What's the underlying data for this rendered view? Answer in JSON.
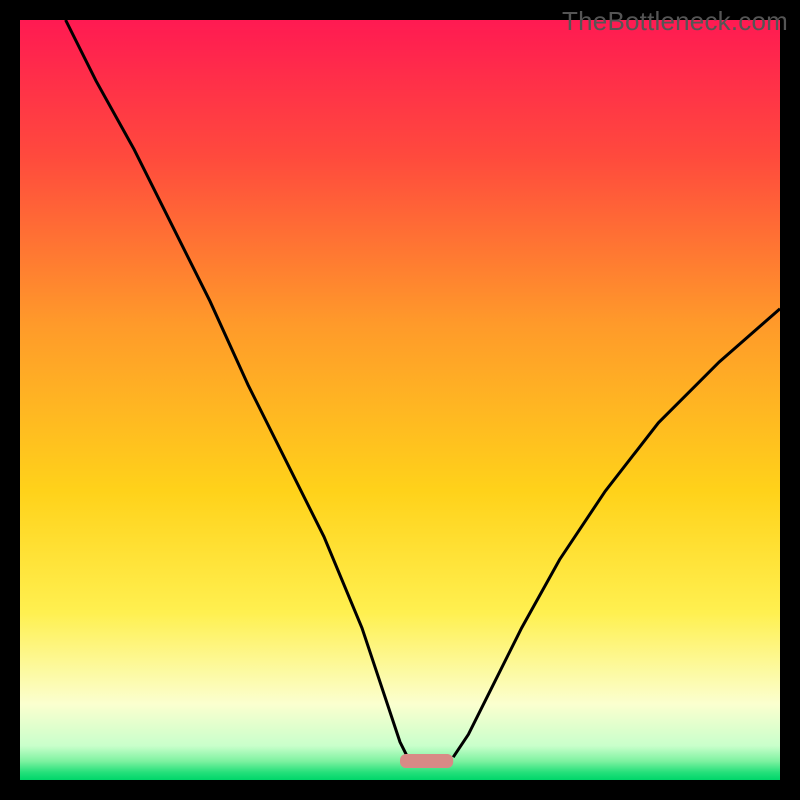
{
  "watermark": "TheBottleneck.com",
  "chart_data": {
    "type": "line",
    "title": "",
    "xlabel": "",
    "ylabel": "",
    "xlim": [
      0,
      100
    ],
    "ylim": [
      0,
      100
    ],
    "background_gradient": {
      "stops": [
        {
          "offset": 0.0,
          "color": "#ff1a52"
        },
        {
          "offset": 0.18,
          "color": "#ff4a3d"
        },
        {
          "offset": 0.4,
          "color": "#ff9a2a"
        },
        {
          "offset": 0.62,
          "color": "#ffd21a"
        },
        {
          "offset": 0.78,
          "color": "#fff050"
        },
        {
          "offset": 0.9,
          "color": "#fbffcf"
        },
        {
          "offset": 0.955,
          "color": "#c9ffcb"
        },
        {
          "offset": 0.975,
          "color": "#7ff2a1"
        },
        {
          "offset": 0.99,
          "color": "#24e07a"
        },
        {
          "offset": 1.0,
          "color": "#00d66a"
        }
      ]
    },
    "series": [
      {
        "name": "bottleneck-curve-left",
        "x": [
          6,
          10,
          15,
          20,
          25,
          30,
          35,
          40,
          45,
          48,
          50,
          51
        ],
        "y": [
          100,
          92,
          83,
          73,
          63,
          52,
          42,
          32,
          20,
          11,
          5,
          3
        ]
      },
      {
        "name": "bottleneck-curve-right",
        "x": [
          57,
          59,
          62,
          66,
          71,
          77,
          84,
          92,
          100
        ],
        "y": [
          3,
          6,
          12,
          20,
          29,
          38,
          47,
          55,
          62
        ]
      }
    ],
    "marker": {
      "name": "optimal-range",
      "x_start": 50,
      "x_end": 57,
      "y": 2.5,
      "color": "#d88a86"
    }
  }
}
